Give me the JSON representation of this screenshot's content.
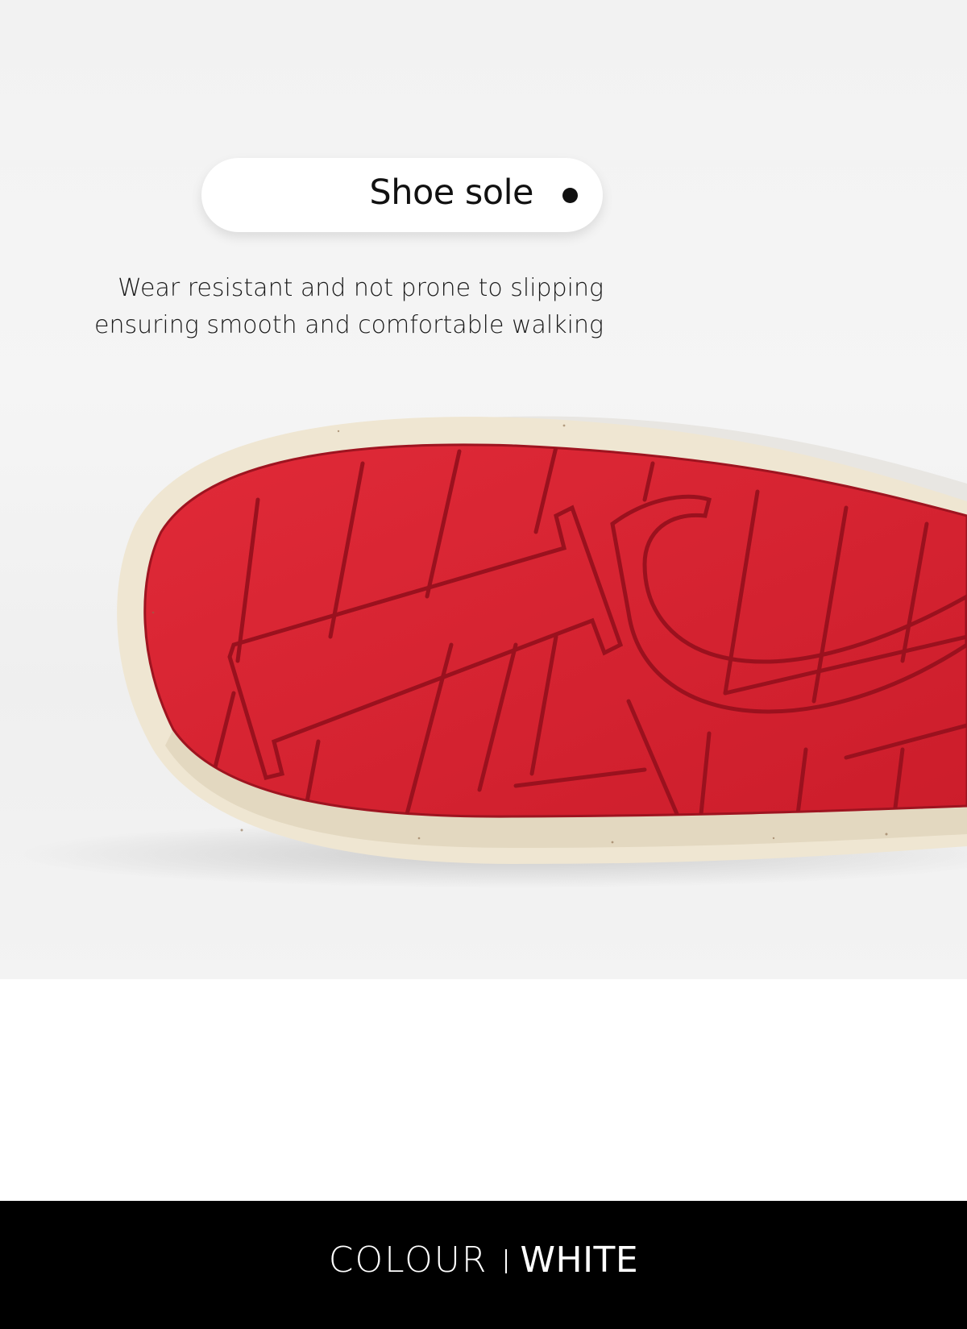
{
  "feature": {
    "title": "Shoe sole",
    "description_line1": "Wear resistant and not prone to slipping",
    "description_line2": "ensuring smooth and comfortable walking"
  },
  "footer": {
    "colour_label": "COLOUR",
    "colour_value": "WHITE"
  },
  "colors": {
    "sole_red": "#d3222f",
    "midsole_cream": "#efe6d2",
    "background": "#f2f2f2",
    "footer_bg": "#000000"
  }
}
